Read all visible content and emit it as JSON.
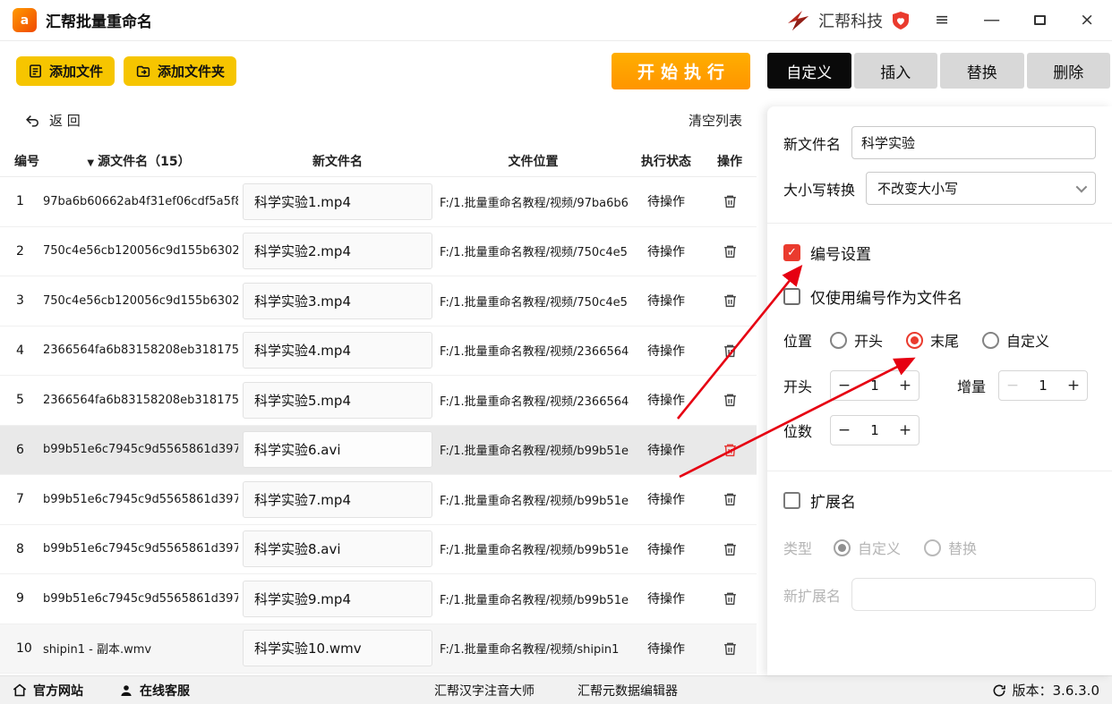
{
  "titlebar": {
    "app_title": "汇帮批量重命名",
    "brand": "汇帮科技"
  },
  "icons": {
    "menu": "≡",
    "minimize": "—",
    "close": "×",
    "sort_desc": "▼",
    "check": "✓",
    "minus": "−",
    "plus": "+",
    "app_glyph": "a"
  },
  "toolbar": {
    "add_file": "添加文件",
    "add_folder": "添加文件夹",
    "start_button": "开始执行"
  },
  "tabs": [
    {
      "label": "自定义",
      "active": true
    },
    {
      "label": "插入",
      "active": false
    },
    {
      "label": "替换",
      "active": false
    },
    {
      "label": "删除",
      "active": false
    }
  ],
  "list_toolbar": {
    "back": "返 回",
    "clear_list": "清空列表"
  },
  "table": {
    "columns": {
      "no": "编号",
      "source": "源文件名（15）",
      "new_name": "新文件名",
      "location": "文件位置",
      "status": "执行状态",
      "action": "操作"
    },
    "rows": [
      {
        "no": "1",
        "source": "97ba6b60662ab4f31ef06cdf5a5f8",
        "new_name": "科学实验1.mp4",
        "location": "F:/1.批量重命名教程/视频/97ba6b6",
        "status": "待操作",
        "selected": false,
        "shaded": false,
        "trash_red": false
      },
      {
        "no": "2",
        "source": "750c4e56cb120056c9d155b6302",
        "new_name": "科学实验2.mp4",
        "location": "F:/1.批量重命名教程/视频/750c4e5",
        "status": "待操作",
        "selected": false,
        "shaded": false,
        "trash_red": false
      },
      {
        "no": "3",
        "source": "750c4e56cb120056c9d155b6302",
        "new_name": "科学实验3.mp4",
        "location": "F:/1.批量重命名教程/视频/750c4e5",
        "status": "待操作",
        "selected": false,
        "shaded": false,
        "trash_red": false
      },
      {
        "no": "4",
        "source": "2366564fa6b83158208eb318175",
        "new_name": "科学实验4.mp4",
        "location": "F:/1.批量重命名教程/视频/2366564",
        "status": "待操作",
        "selected": false,
        "shaded": false,
        "trash_red": false
      },
      {
        "no": "5",
        "source": "2366564fa6b83158208eb318175",
        "new_name": "科学实验5.mp4",
        "location": "F:/1.批量重命名教程/视频/2366564",
        "status": "待操作",
        "selected": false,
        "shaded": false,
        "trash_red": false
      },
      {
        "no": "6",
        "source": "b99b51e6c7945c9d5565861d397",
        "new_name": "科学实验6.avi",
        "location": "F:/1.批量重命名教程/视频/b99b51e",
        "status": "待操作",
        "selected": true,
        "shaded": false,
        "trash_red": true
      },
      {
        "no": "7",
        "source": "b99b51e6c7945c9d5565861d397",
        "new_name": "科学实验7.mp4",
        "location": "F:/1.批量重命名教程/视频/b99b51e",
        "status": "待操作",
        "selected": false,
        "shaded": false,
        "trash_red": false
      },
      {
        "no": "8",
        "source": "b99b51e6c7945c9d5565861d397",
        "new_name": "科学实验8.avi",
        "location": "F:/1.批量重命名教程/视频/b99b51e",
        "status": "待操作",
        "selected": false,
        "shaded": false,
        "trash_red": false
      },
      {
        "no": "9",
        "source": "b99b51e6c7945c9d5565861d397",
        "new_name": "科学实验9.mp4",
        "location": "F:/1.批量重命名教程/视频/b99b51e",
        "status": "待操作",
        "selected": false,
        "shaded": false,
        "trash_red": false
      },
      {
        "no": "10",
        "source": "shipin1 - 副本.wmv",
        "new_name": "科学实验10.wmv",
        "location": "F:/1.批量重命名教程/视频/shipin1",
        "status": "待操作",
        "selected": false,
        "shaded": true,
        "trash_red": false
      }
    ]
  },
  "panel": {
    "new_name_label": "新文件名",
    "new_name_value": "科学实验",
    "case_label": "大小写转换",
    "case_value": "不改变大小写",
    "numbering": {
      "label": "编号设置",
      "checked": true
    },
    "only_number": {
      "label": "仅使用编号作为文件名",
      "checked": false
    },
    "position": {
      "label": "位置",
      "options": [
        {
          "label": "开头",
          "selected": false
        },
        {
          "label": "末尾",
          "selected": true
        },
        {
          "label": "自定义",
          "selected": false
        }
      ]
    },
    "start": {
      "label": "开头",
      "value": "1"
    },
    "increment": {
      "label": "增量",
      "value": "1"
    },
    "digits": {
      "label": "位数",
      "value": "1"
    },
    "extension": {
      "label": "扩展名",
      "checked": false
    },
    "ext_type": {
      "label": "类型",
      "options": [
        {
          "label": "自定义",
          "selected": true
        },
        {
          "label": "替换",
          "selected": false
        }
      ]
    },
    "new_ext_label": "新扩展名",
    "new_ext_value": ""
  },
  "statusbar": {
    "official_site": "官方网站",
    "online_service": "在线客服",
    "links": [
      "汇帮汉字注音大师",
      "汇帮元数据编辑器"
    ],
    "version": "版本：3.6.3.0"
  },
  "colors": {
    "accent_red": "#ea3b2e",
    "button_yellow": "#f6c500",
    "button_orange": "#ff9c00",
    "tab_active_bg": "#0a0a0a",
    "status_bar_bg": "#f1f1f1"
  }
}
